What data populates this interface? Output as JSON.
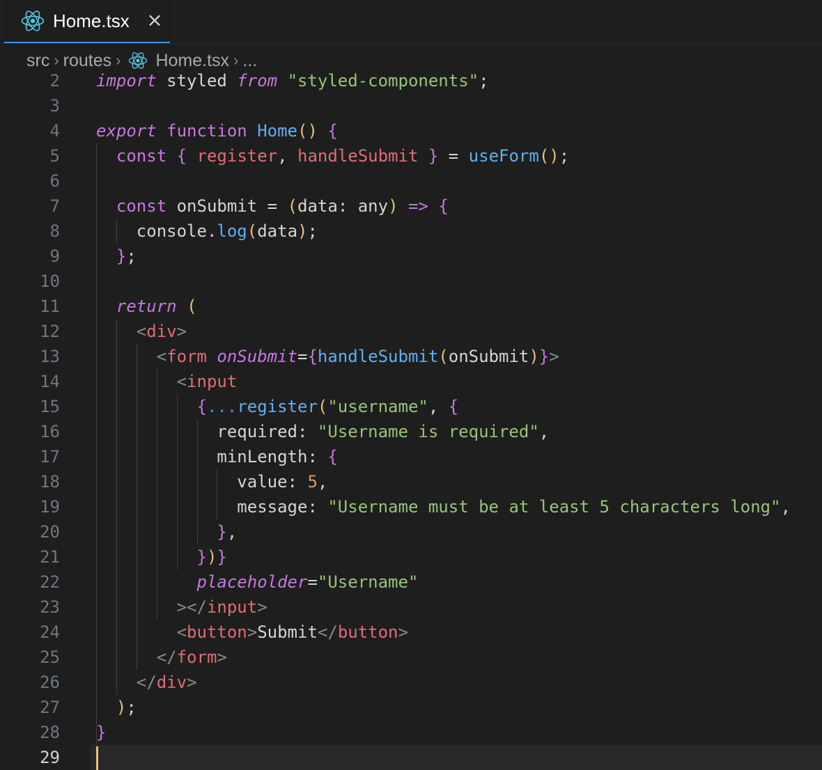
{
  "tab": {
    "title": "Home.tsx",
    "close_glyph": "×",
    "icon": "react-icon"
  },
  "breadcrumb": {
    "items": [
      "src",
      "routes",
      "Home.tsx",
      "..."
    ],
    "separator": "›"
  },
  "colors": {
    "keyword": "#c678dd",
    "function": "#61afef",
    "string": "#98c379",
    "number": "#d19a66",
    "tag": "#e06c75",
    "plain": "#d4d4d4",
    "brace_yellow": "#e5c07b",
    "brace_purple": "#c678dd",
    "brace_blue": "#3794ff",
    "react": "#58c4dc"
  },
  "editor": {
    "active_line": "29",
    "lines": [
      {
        "num": "2",
        "code": "import styled from \"styled-components\";"
      },
      {
        "num": "3",
        "code": ""
      },
      {
        "num": "4",
        "code": "export function Home() {"
      },
      {
        "num": "5",
        "code": "  const { register, handleSubmit } = useForm();"
      },
      {
        "num": "6",
        "code": ""
      },
      {
        "num": "7",
        "code": "  const onSubmit = (data: any) => {"
      },
      {
        "num": "8",
        "code": "    console.log(data);"
      },
      {
        "num": "9",
        "code": "  };"
      },
      {
        "num": "10",
        "code": ""
      },
      {
        "num": "11",
        "code": "  return ("
      },
      {
        "num": "12",
        "code": "    <div>"
      },
      {
        "num": "13",
        "code": "      <form onSubmit={handleSubmit(onSubmit)}>"
      },
      {
        "num": "14",
        "code": "        <input"
      },
      {
        "num": "15",
        "code": "          {...register(\"username\", {"
      },
      {
        "num": "16",
        "code": "            required: \"Username is required\","
      },
      {
        "num": "17",
        "code": "            minLength: {"
      },
      {
        "num": "18",
        "code": "              value: 5,"
      },
      {
        "num": "19",
        "code": "              message: \"Username must be at least 5 characters long\","
      },
      {
        "num": "20",
        "code": "            },"
      },
      {
        "num": "21",
        "code": "          })}"
      },
      {
        "num": "22",
        "code": "          placeholder=\"Username\""
      },
      {
        "num": "23",
        "code": "        ></input>"
      },
      {
        "num": "24",
        "code": "        <button>Submit</button>"
      },
      {
        "num": "25",
        "code": "      </form>"
      },
      {
        "num": "26",
        "code": "    </div>"
      },
      {
        "num": "27",
        "code": "  );"
      },
      {
        "num": "28",
        "code": "}"
      },
      {
        "num": "29",
        "code": ""
      }
    ]
  }
}
